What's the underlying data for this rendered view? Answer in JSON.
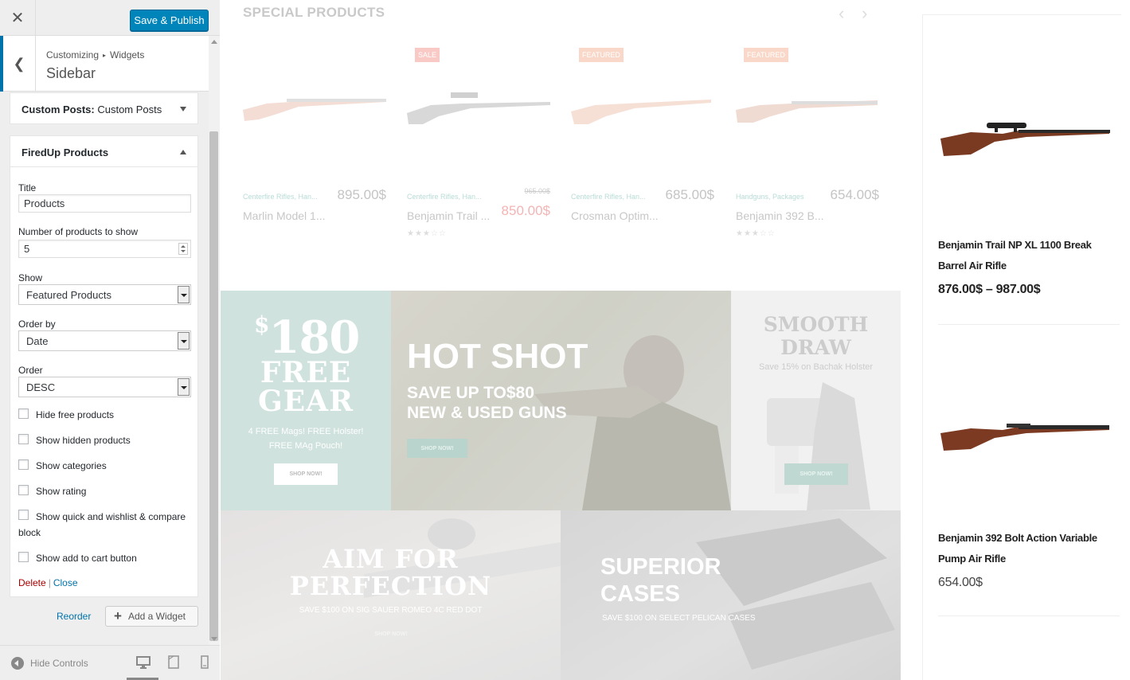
{
  "customizer": {
    "close_icon": "close-icon",
    "publish_label": "Save & Publish",
    "breadcrumb": [
      "Customizing",
      "Widgets"
    ],
    "section_title": "Sidebar",
    "widgets": {
      "custom_posts": {
        "title_prefix": "Custom Posts:",
        "title_value": " Custom Posts"
      },
      "fired_up": {
        "title": "FiredUp Products",
        "fields": {
          "title_label": "Title",
          "title_value": "Products",
          "num_label": "Number of products to show",
          "num_value": "5",
          "show_label": "Show",
          "show_value": "Featured Products",
          "orderby_label": "Order by",
          "orderby_value": "Date",
          "order_label": "Order",
          "order_value": "DESC"
        },
        "checkboxes": [
          "Hide free products",
          "Show hidden products",
          "Show categories",
          "Show rating",
          "Show quick and wishlist & compare block",
          "Show add to cart button"
        ],
        "delete_label": "Delete",
        "separator": "|",
        "close_label": "Close"
      }
    },
    "reorder_label": "Reorder",
    "add_widget_label": "Add a Widget",
    "hide_controls_label": "Hide Controls"
  },
  "preview": {
    "special_title": "SPECIAL PRODUCTS",
    "products": [
      {
        "badge": "",
        "cats": "Centerfire Rifles, Han...",
        "price": "895.00$",
        "old": "",
        "sale": "",
        "name": "Marlin Model 1...",
        "stars": ""
      },
      {
        "badge": "SALE",
        "cats": "Centerfire Rifles, Han...",
        "price": "",
        "old": "965.00$",
        "sale": "850.00$",
        "name": "Benjamin Trail ...",
        "stars": "★★★☆☆"
      },
      {
        "badge": "FEATURED",
        "cats": "Centerfire Rifles, Han...",
        "price": "685.00$",
        "old": "",
        "sale": "",
        "name": "Crosman Optim...",
        "stars": ""
      },
      {
        "badge": "FEATURED",
        "cats": "Handguns, Packages",
        "price": "654.00$",
        "old": "",
        "sale": "",
        "name": "Benjamin 392 B...",
        "stars": "★★★☆☆"
      }
    ],
    "banners": {
      "free_gear": {
        "sup": "$",
        "amount": "180",
        "line1": "FREE",
        "line2": "GEAR",
        "desc": "4 FREE Mags! FREE Holster! FREE MAg Pouch!",
        "btn": "SHOP NOW!"
      },
      "hot_shot": {
        "title": "HOT SHOT",
        "line1": "SAVE UP TO$80",
        "line2": "NEW & USED GUNS",
        "btn": "SHOP NOW!"
      },
      "smooth_draw": {
        "title1": "SMOOTH",
        "title2": "DRAW",
        "desc": "Save 15% on Bachak Holster",
        "btn": "SHOP NOW!"
      },
      "aim": {
        "title1": "AIM FOR",
        "title2": "PERFECTION",
        "desc": "SAVE $100 ON SIG SAUER ROMEO 4C RED DOT",
        "btn": "SHOP NOW!"
      },
      "cases": {
        "title1": "SUPERIOR",
        "title2": "CASES",
        "desc": "SAVE $100 ON SELECT PELICAN CASES"
      }
    },
    "sidebar_products": [
      {
        "name": "Benjamin Trail NP XL 1100 Break Barrel Air Rifle",
        "price": "876.00$ – 987.00$"
      },
      {
        "name": "Benjamin 392 Bolt Action Variable Pump Air Rifle",
        "price": "654.00$"
      }
    ]
  }
}
